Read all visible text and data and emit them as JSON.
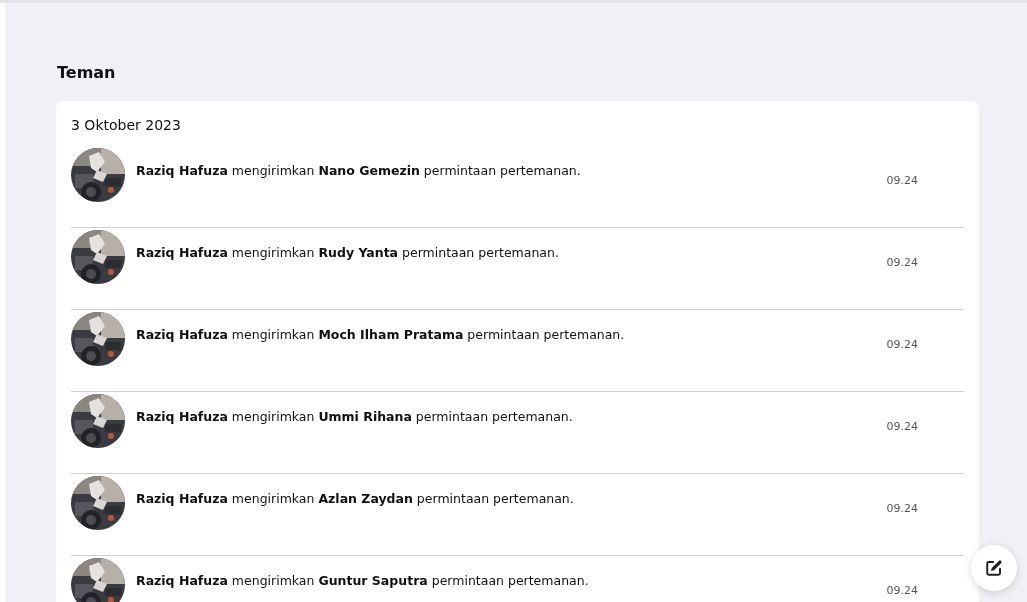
{
  "section_title": "Teman",
  "date": "3 Oktober 2023",
  "notifications": [
    {
      "message": "**Raziq Hafuza** mengirimkan **Nano Gemezin** permintaan pertemanan.",
      "time": "09.24"
    },
    {
      "message": "**Raziq Hafuza** mengirimkan **Rudy Yanta** permintaan pertemanan.",
      "time": "09.24"
    },
    {
      "message": "**Raziq Hafuza** mengirimkan **Moch Ilham Pratama** permintaan pertemanan.",
      "time": "09.24"
    },
    {
      "message": "**Raziq Hafuza** mengirimkan **Ummi Rihana** permintaan pertemanan.",
      "time": "09.24"
    },
    {
      "message": "**Raziq Hafuza** mengirimkan **Azlan Zaydan** permintaan pertemanan.",
      "time": "09.24"
    },
    {
      "message": "**Raziq Hafuza** mengirimkan **Guntur Saputra** permintaan pertemanan.",
      "time": "09.24"
    }
  ]
}
